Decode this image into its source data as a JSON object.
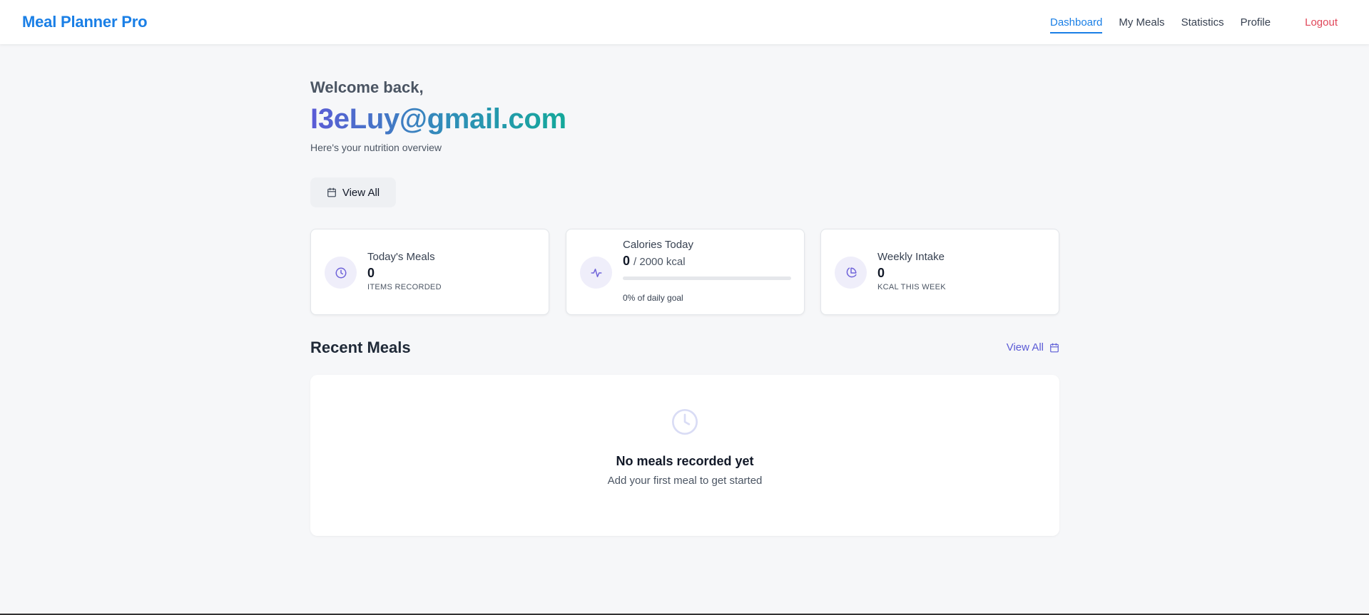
{
  "navbar": {
    "brand": "Meal Planner Pro",
    "links": [
      {
        "label": "Dashboard"
      },
      {
        "label": "My Meals"
      },
      {
        "label": "Statistics"
      },
      {
        "label": "Profile"
      }
    ],
    "logout": "Logout"
  },
  "welcome": {
    "greeting": "Welcome back,",
    "email": "I3eLuy@gmail.com",
    "subtitle": "Here's your nutrition overview"
  },
  "actions": {
    "view_all": "View All"
  },
  "stats": {
    "todays_meals": {
      "label": "Today's Meals",
      "value": "0",
      "caption": "ITEMS RECORDED",
      "icon": "clock-icon"
    },
    "calories_today": {
      "label": "Calories Today",
      "value": "0",
      "goal": "/ 2000 kcal",
      "progress_percent": 0,
      "caption": "0% of daily goal",
      "icon": "activity-icon"
    },
    "weekly_intake": {
      "label": "Weekly Intake",
      "value": "0",
      "caption": "KCAL THIS WEEK",
      "icon": "pie-chart-icon"
    }
  },
  "recent_meals": {
    "title": "Recent Meals",
    "view_all": "View All",
    "empty_title": "No meals recorded yet",
    "empty_subtitle": "Add your first meal to get started"
  },
  "colors": {
    "brand": "#1a7fe6",
    "accent": "#5b5bd6",
    "logout": "#e0475a",
    "email_gradient_start": "#5b5bd6",
    "email_gradient_end": "#14a89a"
  }
}
